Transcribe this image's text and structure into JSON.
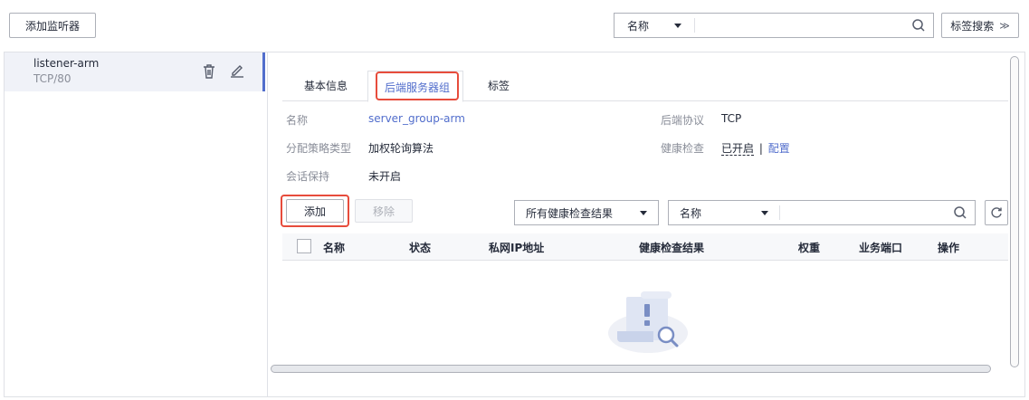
{
  "toolbar": {
    "add_listener": "添加监听器",
    "filter_select": "名称",
    "tag_search": "标签搜索"
  },
  "listener": {
    "name": "listener-arm",
    "protocol_port": "TCP/80"
  },
  "tabs": [
    {
      "label": "基本信息"
    },
    {
      "label": "后端服务器组"
    },
    {
      "label": "标签"
    }
  ],
  "info": {
    "name_label": "名称",
    "name_value": "server_group-arm",
    "strategy_label": "分配策略类型",
    "strategy_value": "加权轮询算法",
    "session_label": "会话保持",
    "session_value": "未开启",
    "protocol_label": "后端协议",
    "protocol_value": "TCP",
    "health_label": "健康检查",
    "health_value": "已开启",
    "health_sep": "|",
    "health_config": "配置"
  },
  "actions": {
    "add": "添加",
    "remove": "移除",
    "health_filter": "所有健康检查结果",
    "name_filter": "名称"
  },
  "table": {
    "headers": [
      "名称",
      "状态",
      "私网IP地址",
      "健康检查结果",
      "权重",
      "业务端口",
      "操作"
    ]
  },
  "colors": {
    "accent": "#526ecc",
    "highlight": "#e74c3c",
    "selected_bg": "#f0f2f8"
  }
}
